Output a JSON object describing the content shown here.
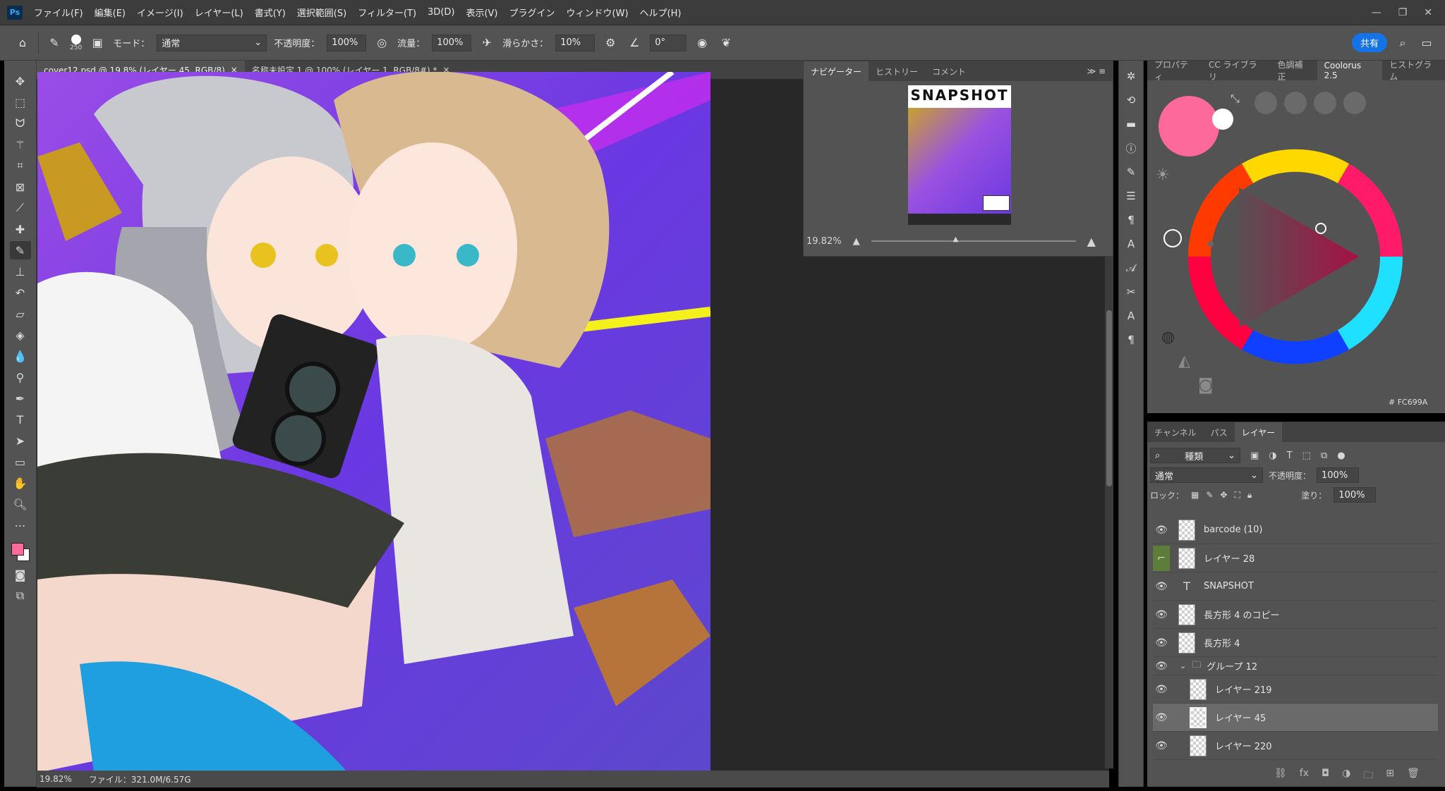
{
  "menubar": {
    "app_logo": "Ps",
    "items": [
      "ファイル(F)",
      "編集(E)",
      "イメージ(I)",
      "レイヤー(L)",
      "書式(Y)",
      "選択範囲(S)",
      "フィルター(T)",
      "3D(D)",
      "表示(V)",
      "プラグイン",
      "ウィンドウ(W)",
      "ヘルプ(H)"
    ]
  },
  "optionsbar": {
    "brush_size": "250",
    "mode_label": "モード：",
    "mode_value": "通常",
    "opacity_label": "不透明度：",
    "opacity_value": "100%",
    "flow_label": "流量：",
    "flow_value": "100%",
    "smoothing_label": "滑らかさ：",
    "smoothing_value": "10%",
    "angle_value": "0°",
    "share_label": "共有"
  },
  "document": {
    "tabs": [
      {
        "label": "cover12.psd @ 19.8% (レイヤー 45, RGB/8)",
        "active": true
      },
      {
        "label": "名称未設定 1 @ 100% (レイヤー 1, RGB/8#) *",
        "active": false
      }
    ],
    "zoom": "19.82%",
    "file_info": "ファイル：321.0M/6.57G"
  },
  "navigator": {
    "tabs": [
      "ナビゲーター",
      "ヒストリー",
      "コメント"
    ],
    "zoom": "19.82%",
    "thumb_title": "SNAPSHOT"
  },
  "colorpanel": {
    "tabs": [
      "プロパティ",
      "CC ライブラリ",
      "色調補正",
      "Coolorus 2.5",
      "ヒストグラム"
    ],
    "active_tab": "Coolorus 2.5",
    "hex_value": "# FC699A",
    "foreground_color": "#fc699a",
    "background_color": "#ffffff"
  },
  "layerspanel": {
    "tabs": [
      "チャンネル",
      "パス",
      "レイヤー"
    ],
    "filter_label": "種類",
    "blend_mode": "通常",
    "opacity_label": "不透明度：",
    "opacity_value": "100%",
    "lock_label": "ロック：",
    "fill_label": "塗り：",
    "fill_value": "100%",
    "layers": [
      {
        "name": "barcode (10)",
        "type": "pixel"
      },
      {
        "name": "レイヤー 28",
        "type": "pixel"
      },
      {
        "name": "SNAPSHOT",
        "type": "text"
      },
      {
        "name": "長方形 4 のコピー",
        "type": "pixel"
      },
      {
        "name": "長方形 4",
        "type": "pixel"
      },
      {
        "name": "グループ 12",
        "type": "group"
      },
      {
        "name": "レイヤー 219",
        "type": "pixel"
      },
      {
        "name": "レイヤー 45",
        "type": "pixel"
      },
      {
        "name": "レイヤー 220",
        "type": "pixel"
      }
    ]
  }
}
